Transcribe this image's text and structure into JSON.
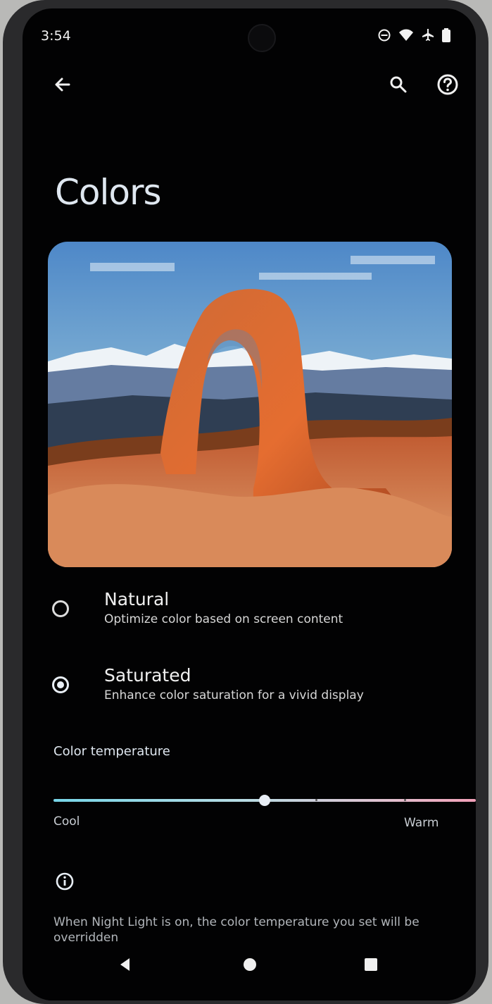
{
  "status_bar": {
    "time": "3:54",
    "icons": [
      "do-not-disturb-icon",
      "wifi-icon",
      "airplane-icon",
      "battery-icon"
    ]
  },
  "toolbar": {
    "back_icon": "arrow-left-icon",
    "search_icon": "search-icon",
    "help_icon": "help-icon"
  },
  "page": {
    "title": "Colors"
  },
  "preview": {
    "image_subject": "natural arch landscape preview"
  },
  "options": [
    {
      "title": "Natural",
      "subtitle": "Optimize color based on screen content",
      "selected": false
    },
    {
      "title": "Saturated",
      "subtitle": "Enhance color saturation for a vivid display",
      "selected": true
    }
  ],
  "color_temperature": {
    "label": "Color temperature",
    "min_label": "Cool",
    "max_label": "Warm",
    "value": 0.5
  },
  "info": {
    "icon": "info-icon",
    "text": "When Night Light is on, the color temperature you set will be overridden"
  },
  "navigation": {
    "back_icon": "triangle-back-icon",
    "home_icon": "circle-home-icon",
    "recents_icon": "square-recents-icon"
  },
  "colors": {
    "background": "#020203",
    "text_primary": "#f0f0f0",
    "accent": "#e8eef5",
    "slider_start": "#77d5e8",
    "slider_end": "#f2a0b8"
  }
}
